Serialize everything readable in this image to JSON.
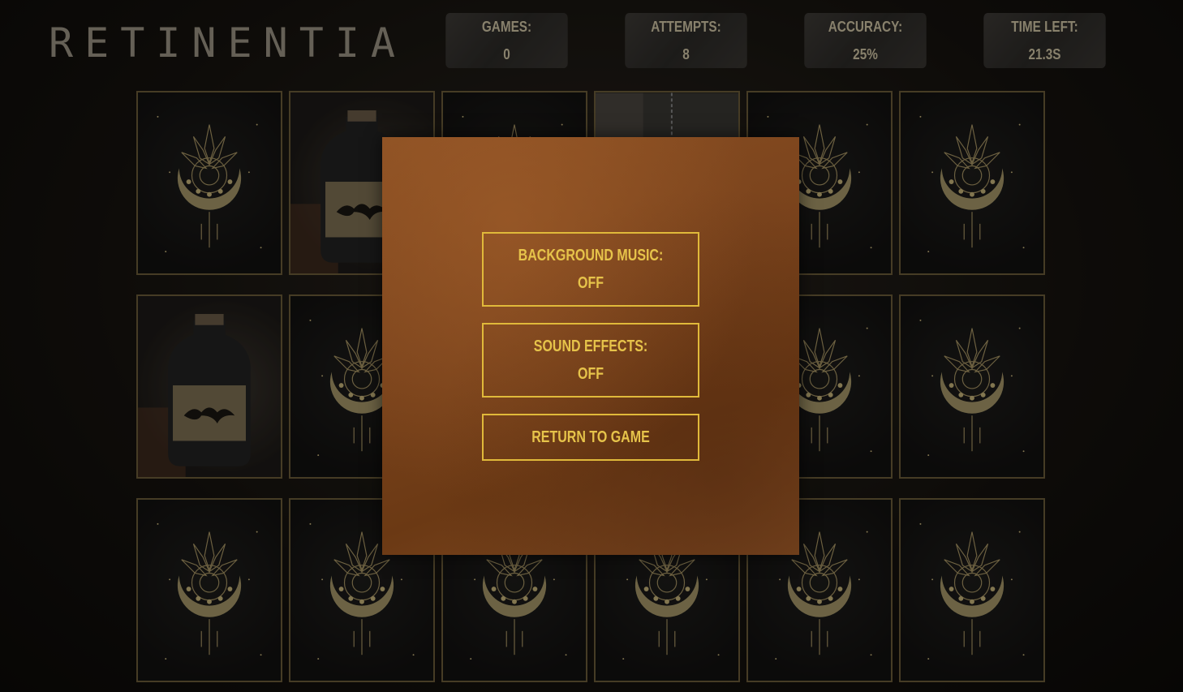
{
  "app": {
    "logo_text": "RETINENTIA"
  },
  "stats": [
    {
      "label": "Games:",
      "value": "0"
    },
    {
      "label": "Attempts:",
      "value": "8"
    },
    {
      "label": "Accuracy:",
      "value": "25%"
    },
    {
      "label": "Time Left:",
      "value": "21.3s"
    }
  ],
  "board": {
    "cards": [
      "back",
      "potion",
      "back",
      "hanging",
      "back",
      "back",
      "potion",
      "back",
      "back",
      "back",
      "back",
      "back",
      "back",
      "back",
      "back",
      "back",
      "back",
      "back"
    ]
  },
  "settings_modal": {
    "music_label": "Background Music:",
    "music_value": "Off",
    "sfx_label": "Sound Effects:",
    "sfx_value": "Off",
    "return_label": "Return to Game"
  },
  "colors": {
    "accent": "#e0b93a",
    "card_border": "#6c5c39",
    "modal": "#7a431c"
  }
}
